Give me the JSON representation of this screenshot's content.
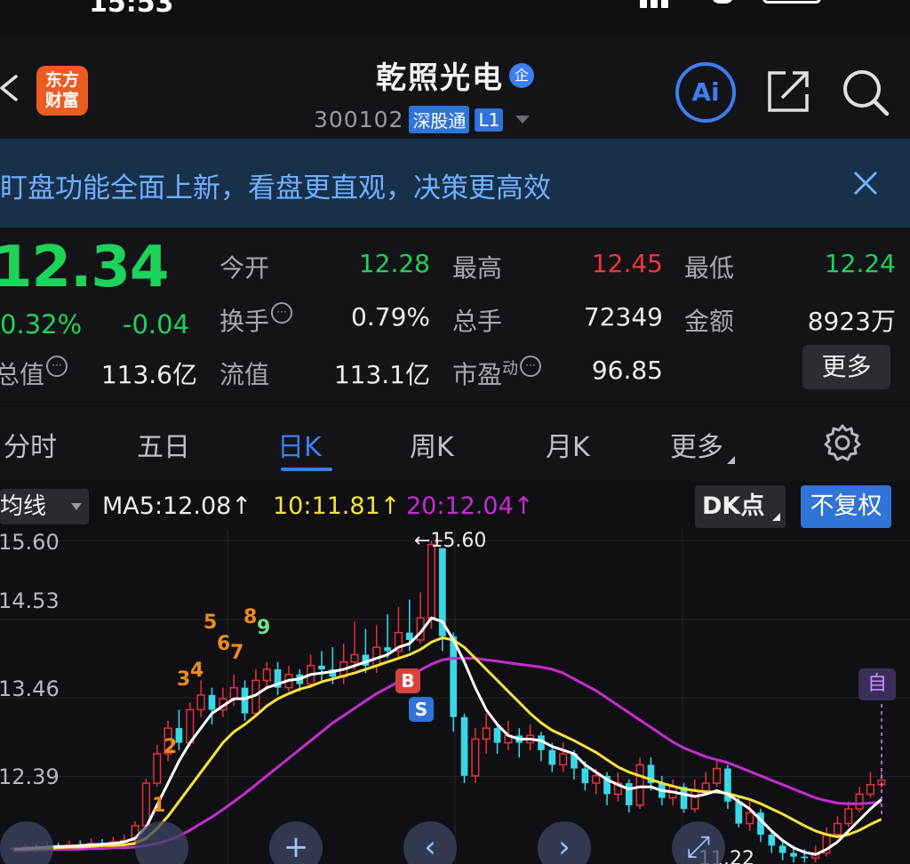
{
  "status_bar": {
    "time": "15:53"
  },
  "header": {
    "back_icon": "chevron-left-icon",
    "logo_lines": [
      "东方",
      "财富"
    ],
    "stock_name": "乾照光电",
    "enterprise_badge": "企",
    "stock_code": "300102",
    "tags": [
      "深股通",
      "L1"
    ],
    "ai_label": "Ai",
    "share_icon": "share-icon",
    "search_icon": "search-icon"
  },
  "banner": {
    "text": "盯盘功能全面上新，看盘更直观，决策更高效",
    "close_icon": "close-icon"
  },
  "quote": {
    "price": "12.34",
    "change_pct": "0.32%",
    "change": "-0.04",
    "fields": [
      {
        "label": "今开",
        "value": "12.28",
        "color": "green"
      },
      {
        "label": "最高",
        "value": "12.45",
        "color": "red"
      },
      {
        "label": "最低",
        "value": "12.24",
        "color": "green"
      },
      {
        "label": "换手",
        "value": "0.79%",
        "color": "white"
      },
      {
        "label": "总手",
        "value": "72349",
        "color": "white"
      },
      {
        "label": "金额",
        "value": "8923万",
        "color": "white"
      },
      {
        "label": "总值",
        "value": "113.6亿",
        "color": "white"
      },
      {
        "label": "流值",
        "value": "113.1亿",
        "color": "white"
      },
      {
        "label": "市盈",
        "label_sup": "动",
        "value": "96.85",
        "color": "white"
      }
    ],
    "more_label": "更多"
  },
  "tabs": {
    "items": [
      "分时",
      "五日",
      "日K",
      "周K",
      "月K",
      "更多"
    ],
    "active": "日K",
    "settings_icon": "gear-icon"
  },
  "indicators": {
    "ma_select": "均线",
    "ma5": "MA5:12.08↑",
    "ma10": "10:11.81↑",
    "ma20": "20:12.04↑",
    "dk_label": "DK点",
    "fq_label": "不复权"
  },
  "chart_data": {
    "type": "candlestick",
    "y_ticks": [
      "15.60",
      "14.53",
      "13.46",
      "12.39"
    ],
    "ylim": [
      11.2,
      15.75
    ],
    "high_label": "←15.60",
    "low_label": "11.22",
    "colors": {
      "up": "#e8303a",
      "down": "#3ad8e6",
      "ma5": "#ffffff",
      "ma10": "#f6e23a",
      "ma20": "#c72bd0"
    },
    "candles": [
      [
        11.4,
        11.42,
        11.45,
        11.35
      ],
      [
        11.42,
        11.43,
        11.48,
        11.36
      ],
      [
        11.43,
        11.41,
        11.47,
        11.36
      ],
      [
        11.41,
        11.44,
        11.5,
        11.37
      ],
      [
        11.44,
        11.42,
        11.49,
        11.38
      ],
      [
        11.42,
        11.46,
        11.52,
        11.4
      ],
      [
        11.46,
        11.45,
        11.52,
        11.4
      ],
      [
        11.45,
        11.48,
        11.55,
        11.42
      ],
      [
        11.48,
        11.47,
        11.54,
        11.41
      ],
      [
        11.47,
        11.5,
        11.57,
        11.44
      ],
      [
        11.5,
        11.52,
        11.6,
        11.45
      ],
      [
        11.52,
        11.72,
        11.78,
        11.48
      ],
      [
        11.72,
        12.3,
        12.36,
        11.7
      ],
      [
        12.3,
        12.7,
        12.82,
        12.25
      ],
      [
        12.7,
        13.05,
        13.15,
        12.6
      ],
      [
        13.05,
        12.85,
        13.3,
        12.75
      ],
      [
        12.85,
        13.3,
        13.4,
        12.8
      ],
      [
        13.3,
        13.5,
        13.7,
        13.2
      ],
      [
        13.5,
        13.3,
        13.6,
        13.1
      ],
      [
        13.3,
        13.45,
        13.6,
        13.2
      ],
      [
        13.45,
        13.6,
        13.78,
        13.35
      ],
      [
        13.6,
        13.25,
        13.7,
        13.15
      ],
      [
        13.25,
        13.7,
        13.85,
        13.2
      ],
      [
        13.7,
        13.85,
        13.95,
        13.6
      ],
      [
        13.85,
        13.6,
        13.95,
        13.5
      ],
      [
        13.6,
        13.78,
        13.9,
        13.55
      ],
      [
        13.78,
        13.65,
        13.85,
        13.55
      ],
      [
        13.65,
        13.9,
        14.05,
        13.6
      ],
      [
        13.9,
        13.85,
        14.1,
        13.7
      ],
      [
        13.85,
        13.75,
        14.15,
        13.65
      ],
      [
        13.75,
        13.95,
        14.2,
        13.65
      ],
      [
        13.95,
        14.05,
        14.5,
        13.85
      ],
      [
        14.05,
        13.9,
        14.4,
        13.8
      ],
      [
        13.9,
        14.15,
        14.45,
        13.8
      ],
      [
        14.15,
        14.1,
        14.6,
        14.0
      ],
      [
        14.1,
        14.35,
        14.7,
        14.0
      ],
      [
        14.35,
        14.25,
        14.8,
        14.1
      ],
      [
        14.25,
        14.55,
        14.9,
        14.2
      ],
      [
        14.55,
        15.55,
        15.6,
        14.4
      ],
      [
        15.5,
        14.3,
        15.5,
        14.1
      ],
      [
        14.3,
        13.2,
        14.35,
        13.0
      ],
      [
        13.2,
        12.4,
        13.25,
        12.3
      ],
      [
        12.4,
        12.9,
        13.05,
        12.3
      ],
      [
        12.9,
        13.05,
        13.25,
        12.7
      ],
      [
        13.05,
        12.85,
        13.1,
        12.7
      ],
      [
        12.85,
        12.95,
        13.15,
        12.75
      ],
      [
        12.95,
        12.85,
        13.05,
        12.65
      ],
      [
        12.85,
        12.95,
        13.1,
        12.75
      ],
      [
        12.95,
        12.75,
        13.0,
        12.6
      ],
      [
        12.75,
        12.55,
        12.85,
        12.45
      ],
      [
        12.55,
        12.7,
        12.85,
        12.45
      ],
      [
        12.7,
        12.5,
        12.75,
        12.35
      ],
      [
        12.5,
        12.3,
        12.6,
        12.2
      ],
      [
        12.3,
        12.4,
        12.5,
        12.15
      ],
      [
        12.4,
        12.15,
        12.45,
        12.0
      ],
      [
        12.15,
        12.3,
        12.45,
        12.05
      ],
      [
        12.3,
        12.0,
        12.35,
        11.9
      ],
      [
        12.0,
        12.55,
        12.65,
        11.95
      ],
      [
        12.55,
        12.3,
        12.65,
        12.2
      ],
      [
        12.3,
        12.1,
        12.4,
        12.0
      ],
      [
        12.1,
        12.25,
        12.35,
        12.0
      ],
      [
        12.25,
        11.95,
        12.3,
        11.9
      ],
      [
        11.95,
        12.2,
        12.35,
        11.9
      ],
      [
        12.2,
        12.3,
        12.45,
        12.15
      ],
      [
        12.3,
        12.5,
        12.6,
        12.25
      ],
      [
        12.5,
        12.05,
        12.55,
        11.95
      ],
      [
        12.05,
        11.75,
        12.1,
        11.7
      ],
      [
        11.75,
        11.9,
        12.05,
        11.65
      ],
      [
        11.9,
        11.6,
        11.95,
        11.5
      ],
      [
        11.6,
        11.45,
        11.65,
        11.35
      ],
      [
        11.45,
        11.35,
        11.5,
        11.25
      ],
      [
        11.35,
        11.3,
        11.45,
        11.22
      ],
      [
        11.3,
        11.28,
        11.4,
        11.22
      ],
      [
        11.28,
        11.35,
        11.45,
        11.22
      ],
      [
        11.35,
        11.6,
        11.7,
        11.3
      ],
      [
        11.6,
        11.75,
        11.85,
        11.55
      ],
      [
        11.75,
        11.95,
        12.05,
        11.7
      ],
      [
        11.95,
        12.15,
        12.25,
        11.9
      ],
      [
        12.15,
        12.28,
        12.45,
        12.1
      ],
      [
        12.28,
        12.34,
        12.45,
        12.24
      ]
    ],
    "ma5": [
      11.4,
      11.41,
      11.42,
      11.43,
      11.44,
      11.44,
      11.45,
      11.46,
      11.47,
      11.48,
      11.5,
      11.55,
      11.7,
      12.0,
      12.3,
      12.6,
      12.85,
      13.05,
      13.25,
      13.35,
      13.45,
      13.45,
      13.5,
      13.6,
      13.65,
      13.7,
      13.72,
      13.78,
      13.8,
      13.82,
      13.85,
      13.9,
      13.95,
      14.0,
      14.05,
      14.15,
      14.2,
      14.35,
      14.55,
      14.5,
      14.25,
      13.95,
      13.6,
      13.3,
      13.1,
      12.95,
      12.9,
      12.9,
      12.88,
      12.8,
      12.75,
      12.7,
      12.55,
      12.45,
      12.35,
      12.28,
      12.22,
      12.25,
      12.25,
      12.2,
      12.18,
      12.15,
      12.12,
      12.15,
      12.2,
      12.15,
      12.05,
      11.95,
      11.8,
      11.65,
      11.52,
      11.42,
      11.36,
      11.33,
      11.4,
      11.5,
      11.65,
      11.8,
      11.95,
      12.08
    ],
    "ma10": [
      11.4,
      11.4,
      11.41,
      11.41,
      11.42,
      11.43,
      11.43,
      11.44,
      11.45,
      11.45,
      11.46,
      11.48,
      11.55,
      11.68,
      11.85,
      12.05,
      12.25,
      12.45,
      12.65,
      12.85,
      13.0,
      13.1,
      13.22,
      13.35,
      13.45,
      13.52,
      13.58,
      13.62,
      13.68,
      13.72,
      13.76,
      13.8,
      13.85,
      13.9,
      13.95,
      14.0,
      14.05,
      14.12,
      14.22,
      14.28,
      14.25,
      14.15,
      14.0,
      13.85,
      13.7,
      13.55,
      13.4,
      13.25,
      13.12,
      13.02,
      12.95,
      12.88,
      12.8,
      12.72,
      12.62,
      12.52,
      12.45,
      12.4,
      12.35,
      12.3,
      12.26,
      12.22,
      12.2,
      12.18,
      12.18,
      12.16,
      12.12,
      12.08,
      12.02,
      11.95,
      11.88,
      11.8,
      11.72,
      11.65,
      11.6,
      11.57,
      11.6,
      11.66,
      11.74,
      11.81
    ],
    "ma20": [
      11.38,
      11.38,
      11.39,
      11.39,
      11.4,
      11.4,
      11.4,
      11.41,
      11.41,
      11.42,
      11.42,
      11.43,
      11.45,
      11.48,
      11.52,
      11.58,
      11.66,
      11.75,
      11.84,
      11.94,
      12.05,
      12.16,
      12.28,
      12.4,
      12.52,
      12.64,
      12.76,
      12.88,
      13.0,
      13.12,
      13.22,
      13.32,
      13.42,
      13.52,
      13.6,
      13.68,
      13.76,
      13.84,
      13.92,
      13.98,
      14.0,
      14.0,
      14.0,
      13.98,
      13.96,
      13.94,
      13.92,
      13.9,
      13.88,
      13.85,
      13.8,
      13.72,
      13.64,
      13.56,
      13.46,
      13.36,
      13.26,
      13.16,
      13.06,
      12.96,
      12.86,
      12.78,
      12.72,
      12.66,
      12.62,
      12.58,
      12.52,
      12.46,
      12.4,
      12.34,
      12.28,
      12.22,
      12.16,
      12.1,
      12.06,
      12.03,
      12.02,
      12.02,
      12.03,
      12.04
    ]
  },
  "chart_annotations": {
    "numbers": [
      "1",
      "2",
      "3",
      "4",
      "5",
      "6",
      "7",
      "8",
      "9"
    ],
    "buy_badge": "B",
    "sell_badge": "S",
    "zi_badge": "自",
    "float_buttons": [
      "+",
      "‹",
      "›",
      "⤢"
    ]
  }
}
